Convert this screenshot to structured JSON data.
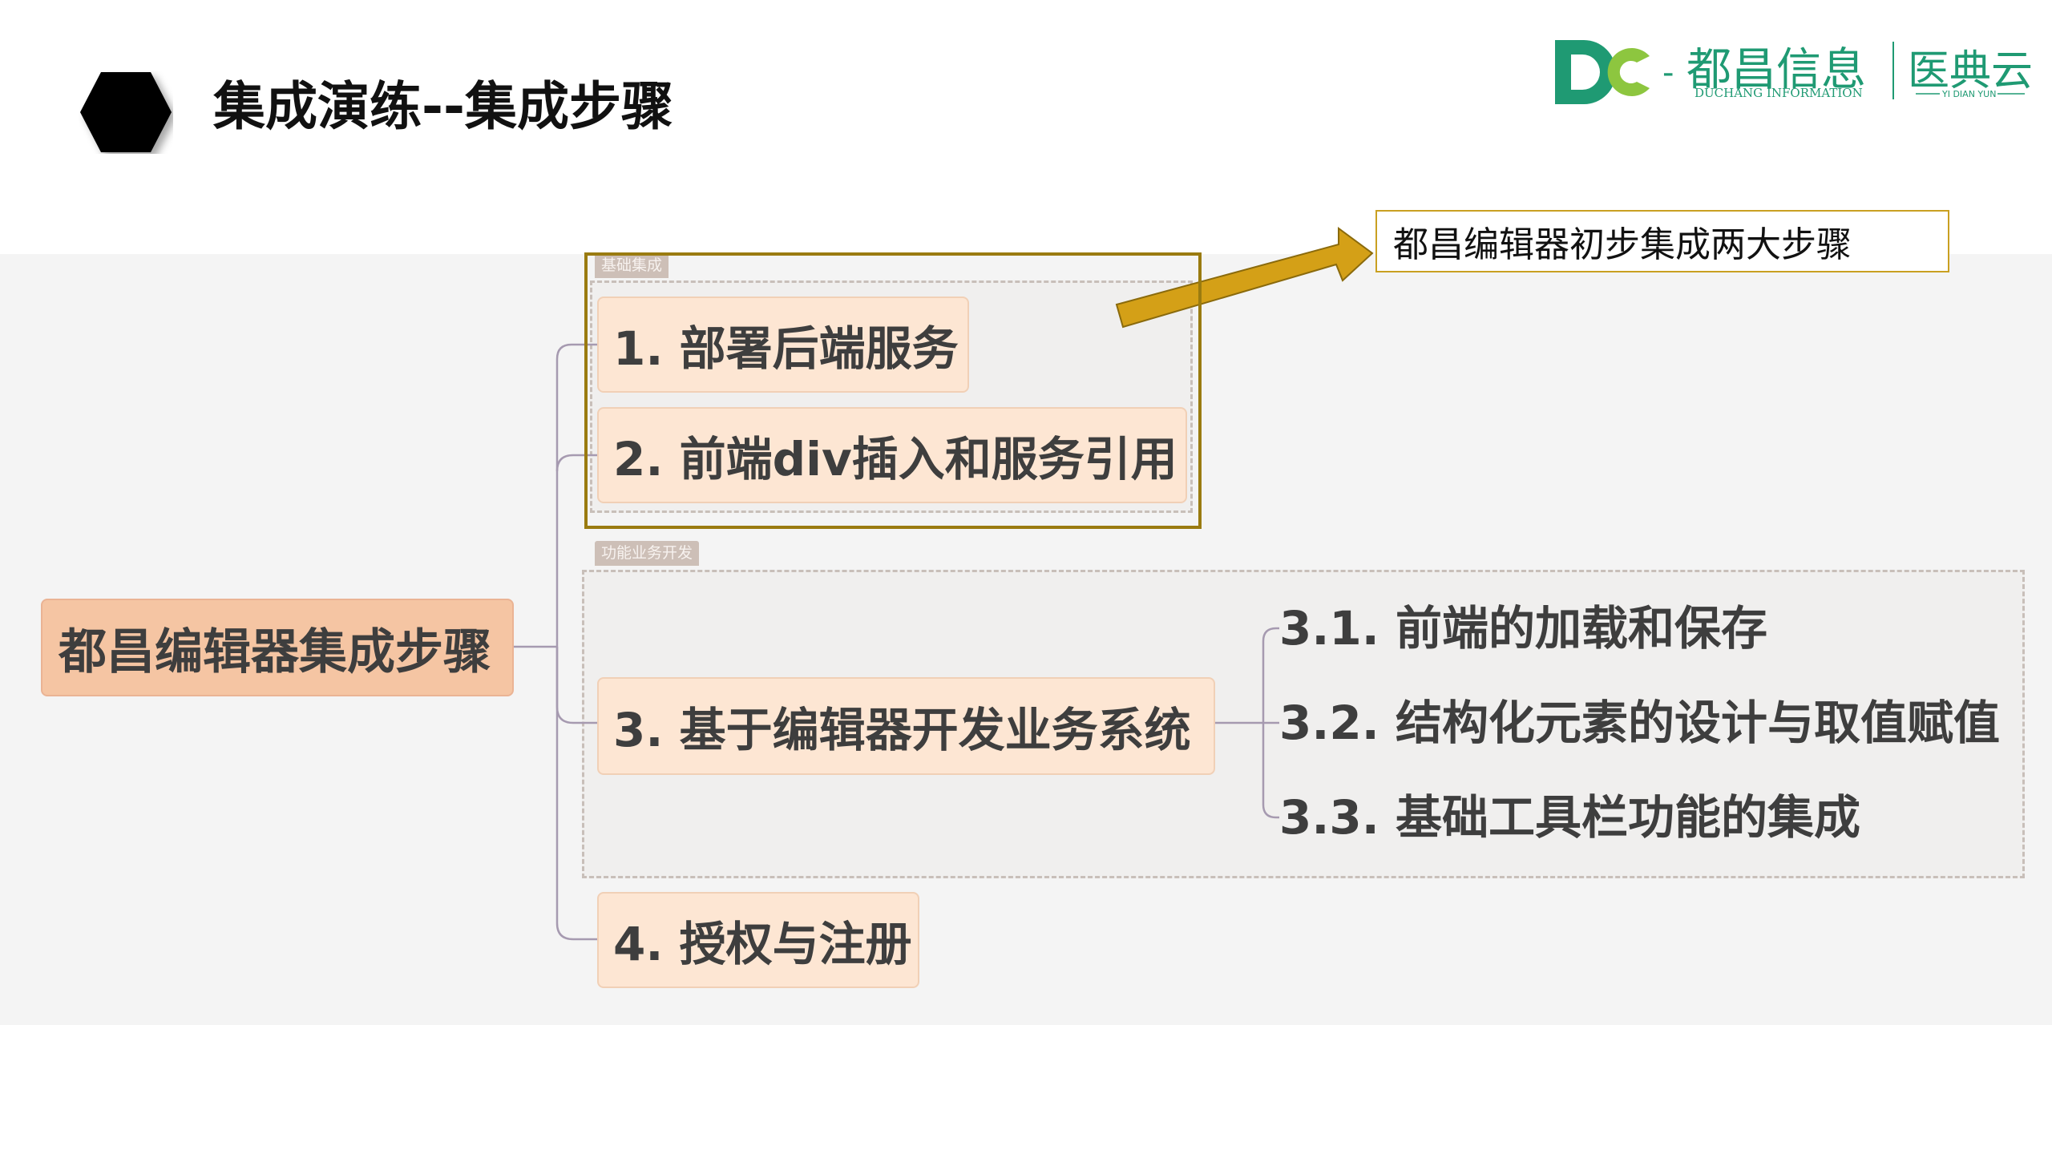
{
  "header": {
    "title": "集成演练--集成步骤"
  },
  "logo": {
    "brand_cn": "都昌信息",
    "brand_en": "DUCHANG INFORMATION",
    "product_cn": "医典云",
    "product_en": "YI DIAN YUN"
  },
  "mindmap": {
    "root": "都昌编辑器集成步骤",
    "groups": {
      "basic": "基础集成",
      "business": "功能业务开发"
    },
    "nodes": [
      "1. 部署后端服务",
      "2. 前端div插入和服务引用",
      "3. 基于编辑器开发业务系统",
      "4. 授权与注册"
    ],
    "sub_nodes": [
      "3.1. 前端的加载和保存",
      "3.2. 结构化元素的设计与取值赋值",
      "3.3. 基础工具栏功能的集成"
    ]
  },
  "callout": "都昌编辑器初步集成两大步骤",
  "colors": {
    "node_fill": "#fde6d3",
    "root_fill": "#f5c5a3",
    "highlight_border": "#9a7b10",
    "arrow": "#d4a017",
    "logo_green": "#1f9a73",
    "logo_lime": "#8dc63f"
  }
}
